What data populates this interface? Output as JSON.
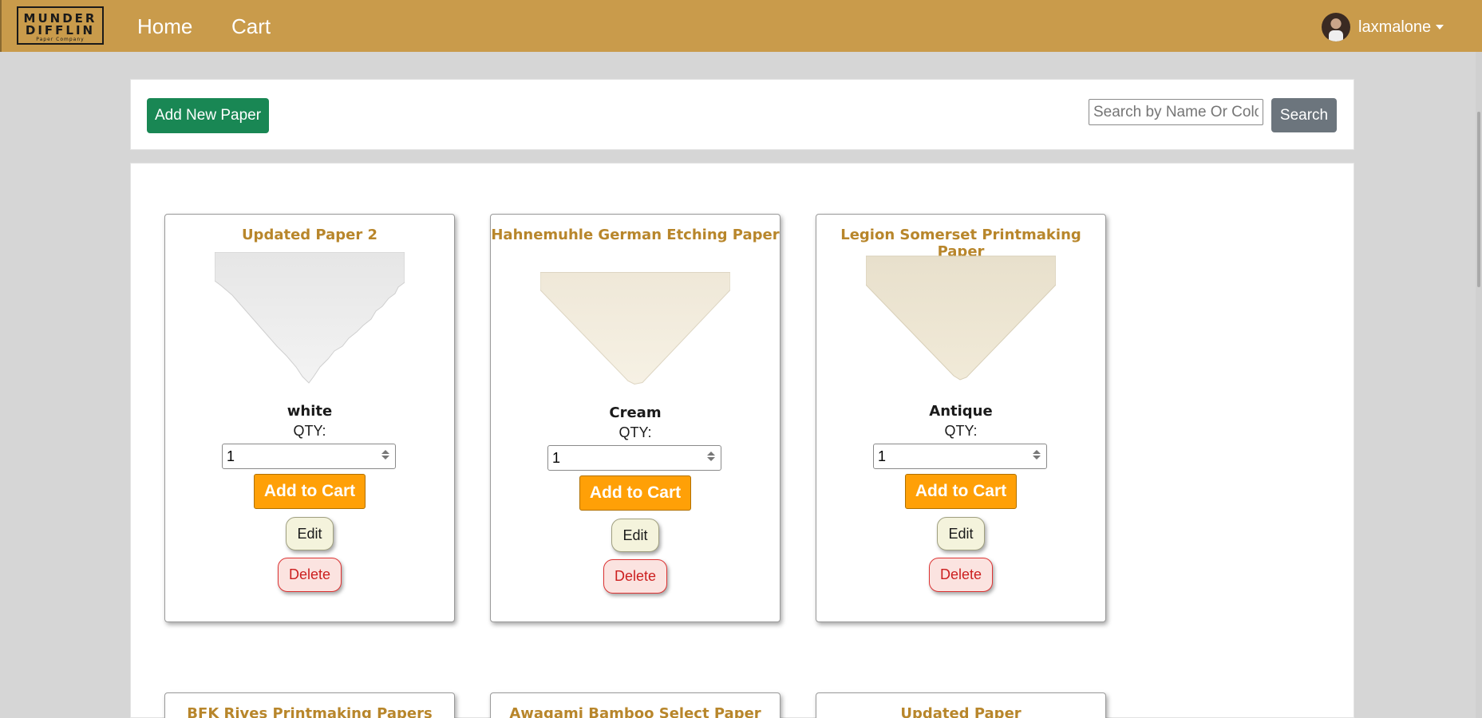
{
  "navbar": {
    "logo": {
      "line1": "MUNDER",
      "line2": "DIFFLIN",
      "line3": "Paper Company"
    },
    "links": [
      "Home",
      "Cart"
    ],
    "username": "laxmalone"
  },
  "toolbar": {
    "add_label": "Add New Paper",
    "search_placeholder": "Search by Name Or Color",
    "search_label": "Search"
  },
  "cards": [
    {
      "title": "Updated Paper 2",
      "color": "white",
      "qty_label": "QTY:",
      "qty": "1",
      "cart_label": "Add to Cart",
      "edit_label": "Edit",
      "delete_label": "Delete"
    },
    {
      "title": "Hahnemuhle German Etching Paper",
      "color": "Cream",
      "qty_label": "QTY:",
      "qty": "1",
      "cart_label": "Add to Cart",
      "edit_label": "Edit",
      "delete_label": "Delete"
    },
    {
      "title": "Legion Somerset Printmaking Paper",
      "color": "Antique",
      "qty_label": "QTY:",
      "qty": "1",
      "cart_label": "Add to Cart",
      "edit_label": "Edit",
      "delete_label": "Delete"
    },
    {
      "title": "BFK Rives Printmaking Papers"
    },
    {
      "title": "Awagami Bamboo Select Paper"
    },
    {
      "title": "Updated Paper"
    }
  ],
  "colors": {
    "navbar": "#c99b4b",
    "title": "#b8862b",
    "add_button": "#198754",
    "search_button": "#6c757d",
    "cart_button": "#ffa007",
    "edit_button": "#f4f3dc",
    "delete_text": "#cc1f1f"
  }
}
